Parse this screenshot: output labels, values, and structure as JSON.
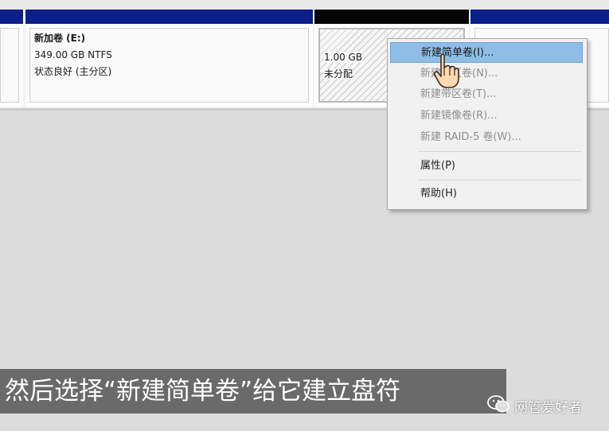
{
  "volumes": [
    {
      "name": "",
      "size": "",
      "status": ""
    },
    {
      "name": "新加卷  (E:)",
      "size": "349.00 GB NTFS",
      "status": "状态良好 (主分区)"
    },
    {
      "name": "",
      "size": "1.00 GB",
      "status": "未分配"
    },
    {
      "name": "",
      "size": "",
      "status": ""
    }
  ],
  "context_menu": {
    "items": [
      {
        "label": "新建简单卷(I)...",
        "enabled": true,
        "highlighted": true
      },
      {
        "label": "新建跨区卷(N)...",
        "enabled": false
      },
      {
        "label": "新建带区卷(T)...",
        "enabled": false
      },
      {
        "label": "新建镜像卷(R)...",
        "enabled": false
      },
      {
        "label": "新建 RAID-5 卷(W)...",
        "enabled": false
      },
      {
        "label": "属性(P)",
        "enabled": true
      },
      {
        "label": "帮助(H)",
        "enabled": true
      }
    ]
  },
  "subtitle": "然后选择“新建简单卷”给它建立盘符",
  "watermark": {
    "text": "网管爱好者",
    "icon": "wechat-icon"
  },
  "cursor": {
    "icon": "hand-pointer-icon"
  },
  "colors": {
    "volume_bar": "#0a1f8a",
    "unallocated_bar": "#050505",
    "menu_highlight": "#8fbde6"
  }
}
